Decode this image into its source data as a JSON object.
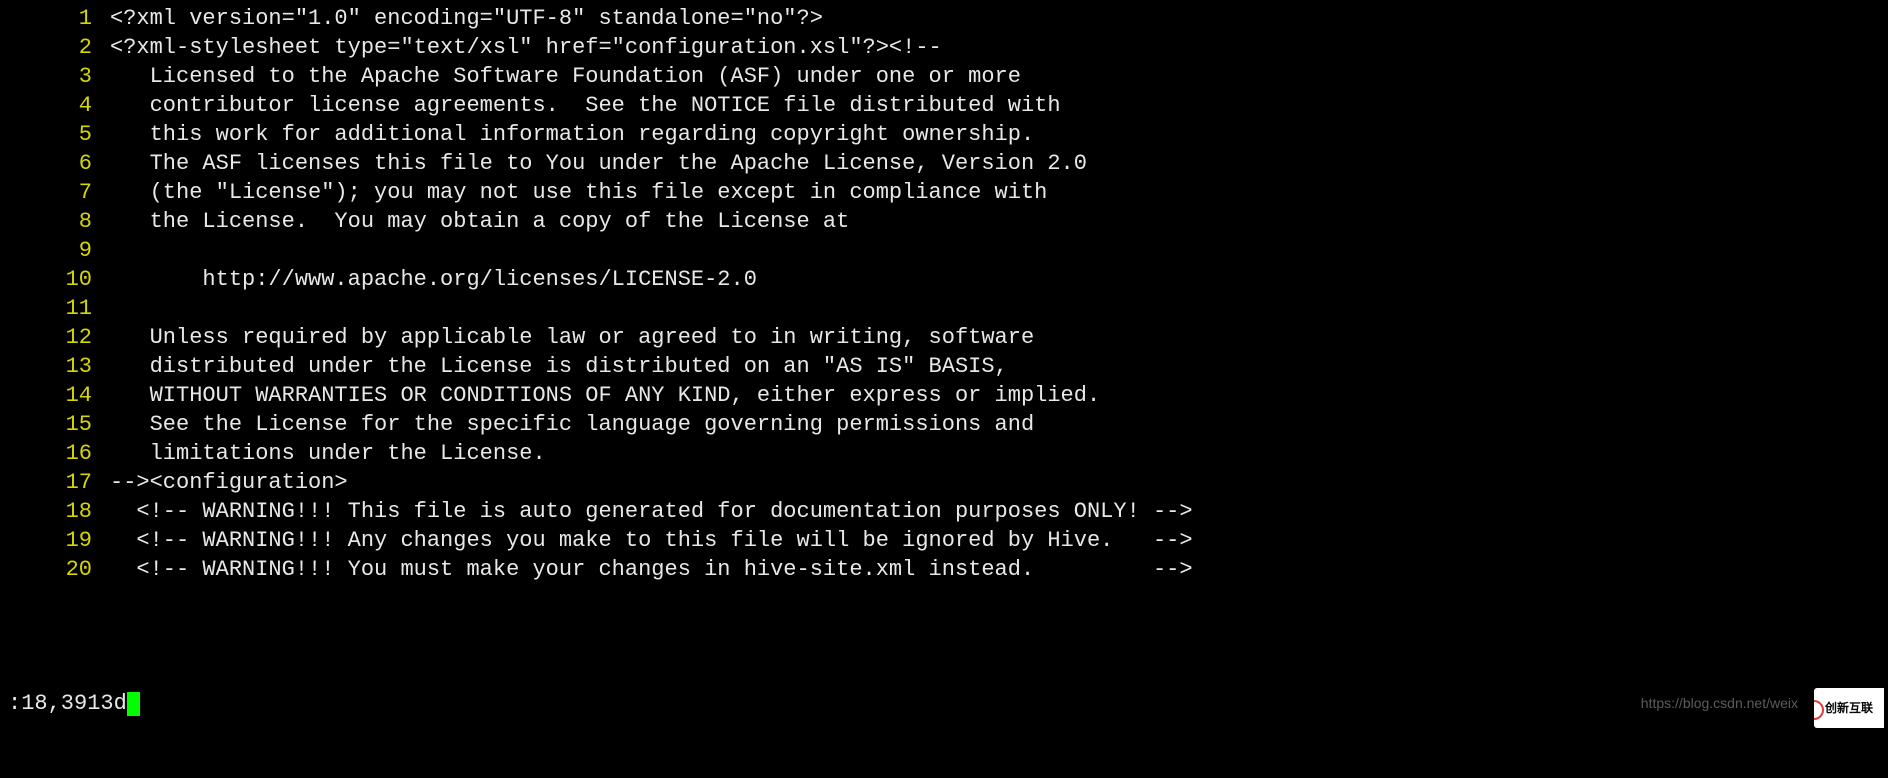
{
  "editor": {
    "lines": [
      {
        "n": "1",
        "text": "<?xml version=\"1.0\" encoding=\"UTF-8\" standalone=\"no\"?>"
      },
      {
        "n": "2",
        "text": "<?xml-stylesheet type=\"text/xsl\" href=\"configuration.xsl\"?><!--"
      },
      {
        "n": "3",
        "text": "   Licensed to the Apache Software Foundation (ASF) under one or more"
      },
      {
        "n": "4",
        "text": "   contributor license agreements.  See the NOTICE file distributed with"
      },
      {
        "n": "5",
        "text": "   this work for additional information regarding copyright ownership."
      },
      {
        "n": "6",
        "text": "   The ASF licenses this file to You under the Apache License, Version 2.0"
      },
      {
        "n": "7",
        "text": "   (the \"License\"); you may not use this file except in compliance with"
      },
      {
        "n": "8",
        "text": "   the License.  You may obtain a copy of the License at"
      },
      {
        "n": "9",
        "text": ""
      },
      {
        "n": "10",
        "text": "       http://www.apache.org/licenses/LICENSE-2.0"
      },
      {
        "n": "11",
        "text": ""
      },
      {
        "n": "12",
        "text": "   Unless required by applicable law or agreed to in writing, software"
      },
      {
        "n": "13",
        "text": "   distributed under the License is distributed on an \"AS IS\" BASIS,"
      },
      {
        "n": "14",
        "text": "   WITHOUT WARRANTIES OR CONDITIONS OF ANY KIND, either express or implied."
      },
      {
        "n": "15",
        "text": "   See the License for the specific language governing permissions and"
      },
      {
        "n": "16",
        "text": "   limitations under the License."
      },
      {
        "n": "17",
        "text": "--><configuration>"
      },
      {
        "n": "18",
        "text": "  <!-- WARNING!!! This file is auto generated for documentation purposes ONLY! -->"
      },
      {
        "n": "19",
        "text": "  <!-- WARNING!!! Any changes you make to this file will be ignored by Hive.   -->"
      },
      {
        "n": "20",
        "text": "  <!-- WARNING!!! You must make your changes in hive-site.xml instead.         -->"
      }
    ]
  },
  "command_line": ":18,3913d",
  "watermark": {
    "url_text": "https://blog.csdn.net/weix",
    "logo_text": "创新互联"
  }
}
